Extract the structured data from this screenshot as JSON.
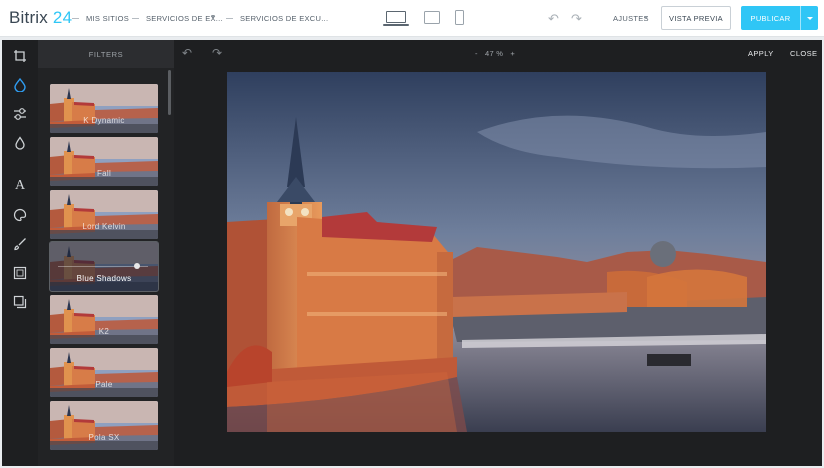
{
  "app": {
    "logo_text": "Bitrix",
    "logo_number": "24",
    "accent_color": "#2fc6f6"
  },
  "breadcrumbs": [
    {
      "label": "MIS SITIOS"
    },
    {
      "label": "SERVICIOS DE EX..."
    },
    {
      "label": "SERVICIOS DE EXCU..."
    }
  ],
  "devices": [
    "laptop-icon",
    "tablet-icon",
    "phone-icon"
  ],
  "header": {
    "settings_label": "AJUSTES",
    "preview_label": "VISTA PREVIA",
    "publish_label": "PUBLICAR"
  },
  "editor": {
    "panel_title": "FILTERS",
    "zoom_minus": "-",
    "zoom_value": "47 %",
    "zoom_plus": "+",
    "apply_label": "APPLY",
    "close_label": "CLOSE",
    "tools": [
      "crop-icon",
      "filters-icon",
      "adjust-icon",
      "focus-icon",
      "text-icon",
      "color-icon",
      "brush-icon",
      "frame-icon",
      "overlay-icon"
    ],
    "filters": [
      {
        "name": "K Dynamic",
        "selected": false
      },
      {
        "name": "Fall",
        "selected": false
      },
      {
        "name": "Lord Kelvin",
        "selected": false
      },
      {
        "name": "Blue Shadows",
        "selected": true,
        "intensity": 0.9
      },
      {
        "name": "K2",
        "selected": false
      },
      {
        "name": "Pale",
        "selected": false
      },
      {
        "name": "Pola SX",
        "selected": false
      }
    ]
  }
}
